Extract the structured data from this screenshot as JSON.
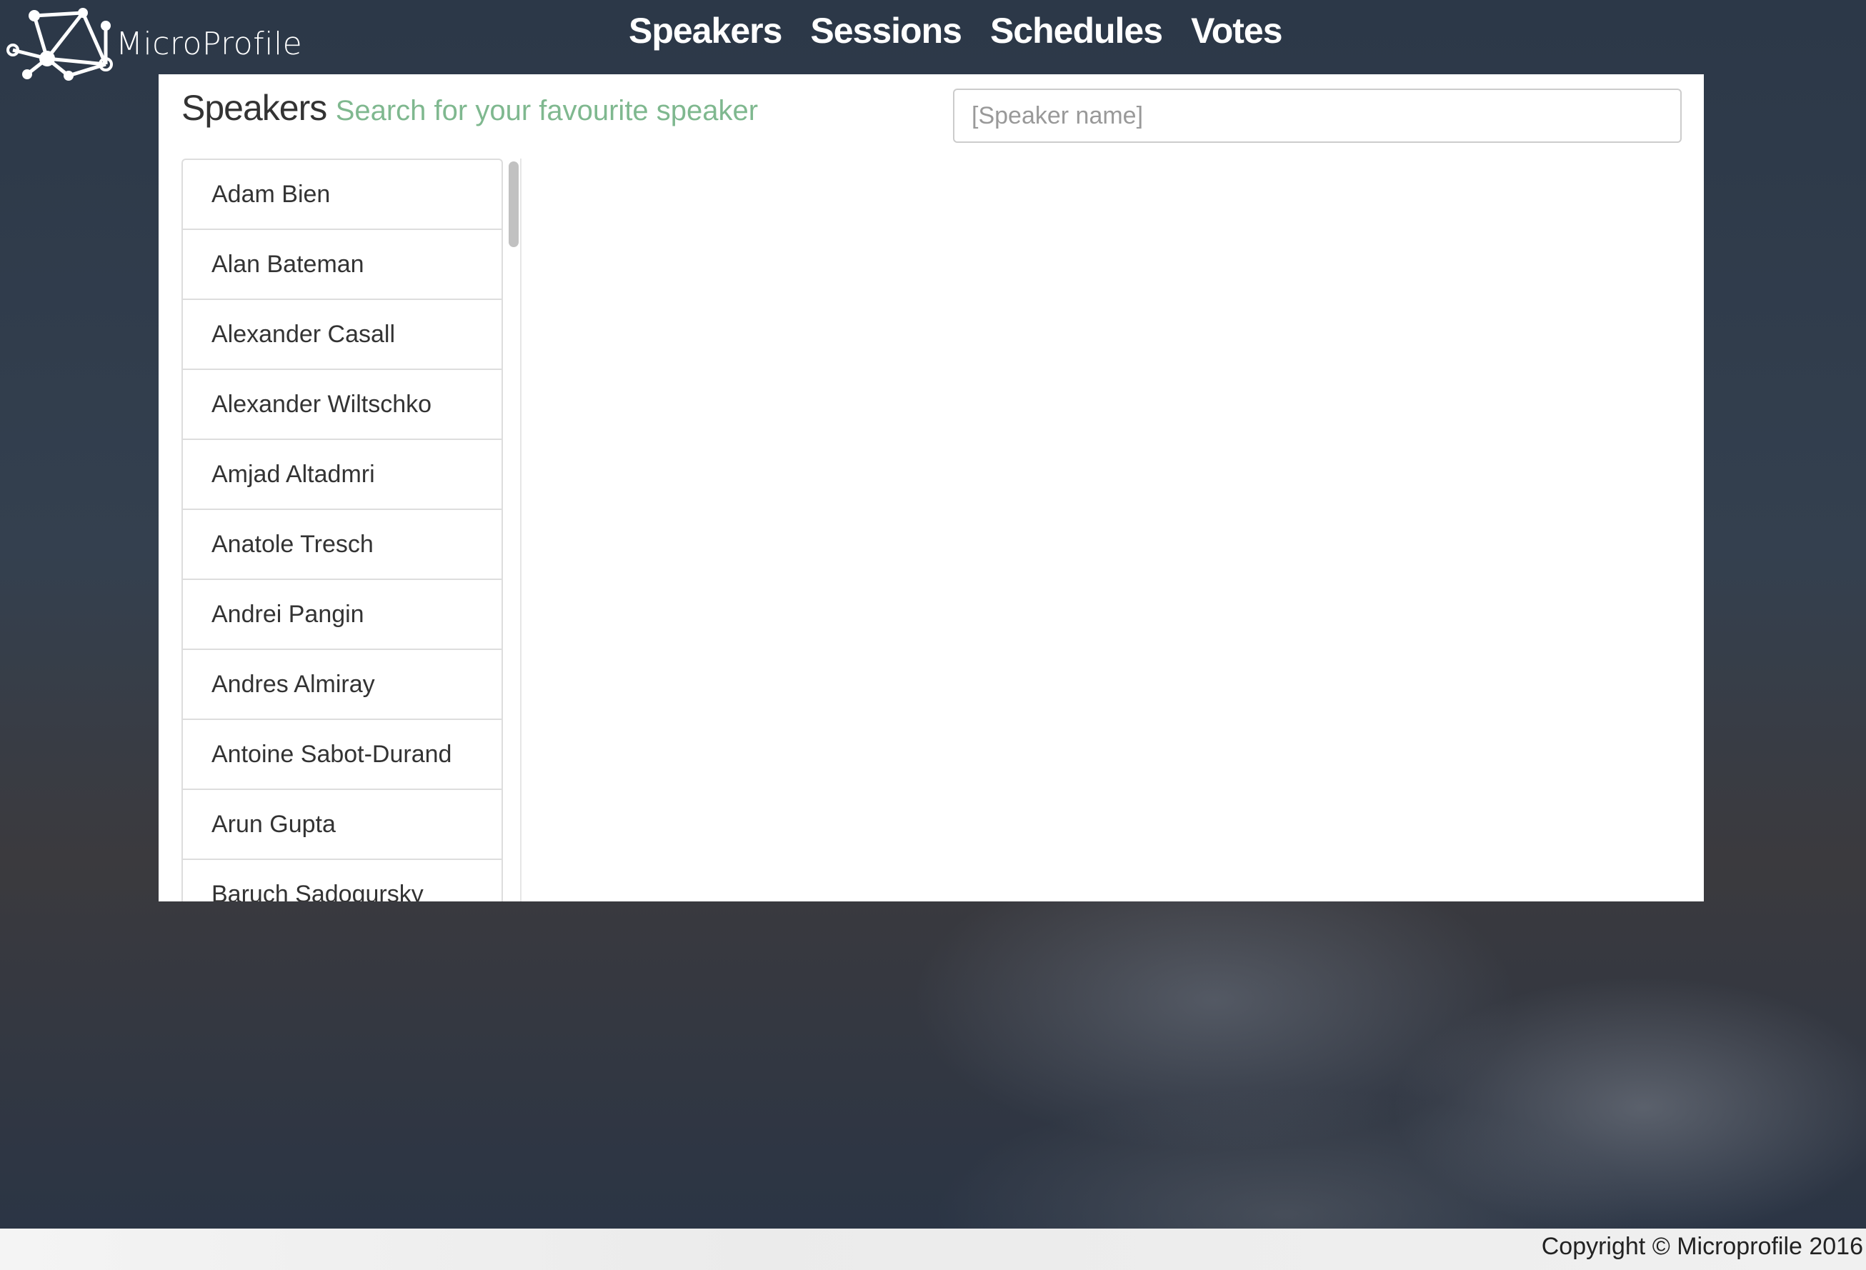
{
  "brand": {
    "name": "MicroProfile"
  },
  "nav": {
    "speakers": "Speakers",
    "sessions": "Sessions",
    "schedules": "Schedules",
    "votes": "Votes"
  },
  "page": {
    "title": "Speakers",
    "subtitle": "Search for your favourite speaker"
  },
  "search": {
    "placeholder": "[Speaker name]",
    "value": ""
  },
  "speakers": [
    "Adam Bien",
    "Alan Bateman",
    "Alexander Casall",
    "Alexander Wiltschko",
    "Amjad Altadmri",
    "Anatole Tresch",
    "Andrei Pangin",
    "Andres Almiray",
    "Antoine Sabot-Durand",
    "Arun Gupta",
    "Baruch Sadogursky"
  ],
  "footer": {
    "copyright": "Copyright © Microprofile 2016"
  }
}
